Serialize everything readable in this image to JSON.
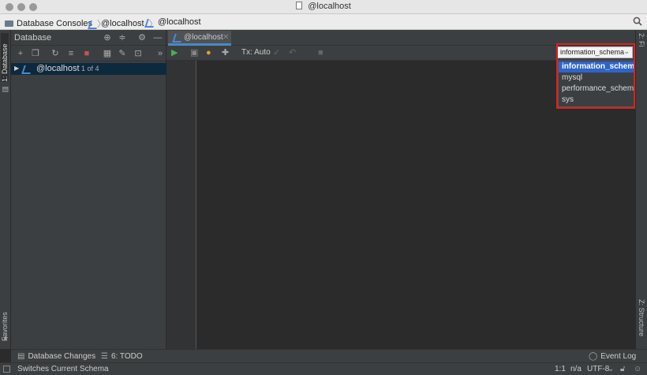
{
  "window": {
    "title": "@localhost"
  },
  "breadcrumb": [
    {
      "label": "Database Consoles",
      "icon": "folder-icon"
    },
    {
      "label": "@localhost",
      "icon": "datasource-icon"
    },
    {
      "label": "@localhost",
      "icon": "console-icon"
    }
  ],
  "left_strip": {
    "database_tab": "1: Database",
    "favorites_tab": "Favorites"
  },
  "right_strip": {
    "top_tab": "2: Fi",
    "structure_tab": "Z: Structure"
  },
  "db_panel": {
    "title": "Database",
    "tree": [
      {
        "label": "@localhost",
        "count": "1 of 4"
      }
    ]
  },
  "editor": {
    "tab_label": "@localhost",
    "tx_mode": "Tx: Auto",
    "schema": "information_schema",
    "schema_options": [
      "information_schema",
      "mysql",
      "performance_schema",
      "sys"
    ],
    "selected_index": 0
  },
  "bottom_tools": {
    "db_changes": "Database Changes",
    "todo": "6: TODO",
    "event_log": "Event Log"
  },
  "status": {
    "message": "Switches Current Schema",
    "position": "1:1",
    "na": "n/a",
    "encoding": "UTF-8"
  }
}
